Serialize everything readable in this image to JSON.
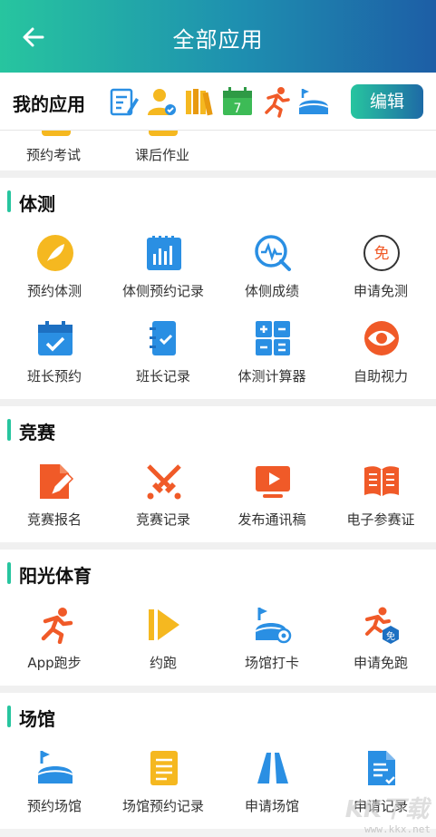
{
  "header": {
    "title": "全部应用"
  },
  "my_apps": {
    "label": "我的应用",
    "edit_label": "编辑",
    "icons": [
      "exam-icon",
      "user-check-icon",
      "books-icon",
      "calendar-icon",
      "runner-icon",
      "stadium-icon"
    ],
    "calendar_day": "7",
    "partial_items": [
      "预约考试",
      "课后作业"
    ]
  },
  "sections": [
    {
      "title": "体测",
      "items": [
        {
          "label": "预约体测",
          "icon": "quill-icon"
        },
        {
          "label": "体侧预约记录",
          "icon": "bar-chart-icon"
        },
        {
          "label": "体侧成绩",
          "icon": "pulse-search-icon"
        },
        {
          "label": "申请免测",
          "icon": "exempt-icon",
          "glyph": "免"
        },
        {
          "label": "班长预约",
          "icon": "calendar-check-icon"
        },
        {
          "label": "班长记录",
          "icon": "notebook-icon"
        },
        {
          "label": "体测计算器",
          "icon": "calculator-icon"
        },
        {
          "label": "自助视力",
          "icon": "eye-icon"
        }
      ]
    },
    {
      "title": "竞赛",
      "items": [
        {
          "label": "竞赛报名",
          "icon": "edit-doc-icon"
        },
        {
          "label": "竞赛记录",
          "icon": "crossed-swords-icon"
        },
        {
          "label": "发布通讯稿",
          "icon": "play-screen-icon"
        },
        {
          "label": "电子参赛证",
          "icon": "open-book-icon"
        }
      ]
    },
    {
      "title": "阳光体育",
      "items": [
        {
          "label": "App跑步",
          "icon": "runner-icon"
        },
        {
          "label": "约跑",
          "icon": "fast-forward-icon"
        },
        {
          "label": "场馆打卡",
          "icon": "stadium-pin-icon"
        },
        {
          "label": "申请免跑",
          "icon": "runner-exempt-icon",
          "glyph": "免"
        }
      ]
    },
    {
      "title": "场馆",
      "items": [
        {
          "label": "预约场馆",
          "icon": "stadium-icon"
        },
        {
          "label": "场馆预约记录",
          "icon": "list-doc-icon"
        },
        {
          "label": "申请场馆",
          "icon": "road-icon"
        },
        {
          "label": "申请记录",
          "icon": "doc-check-icon"
        }
      ]
    }
  ],
  "watermark": {
    "logo": "KK下载",
    "url": "www.kkx.net"
  },
  "colors": {
    "accent": "#27c59f",
    "orange": "#f05a28",
    "blue": "#2a8fe3",
    "yellow": "#f5b820"
  }
}
